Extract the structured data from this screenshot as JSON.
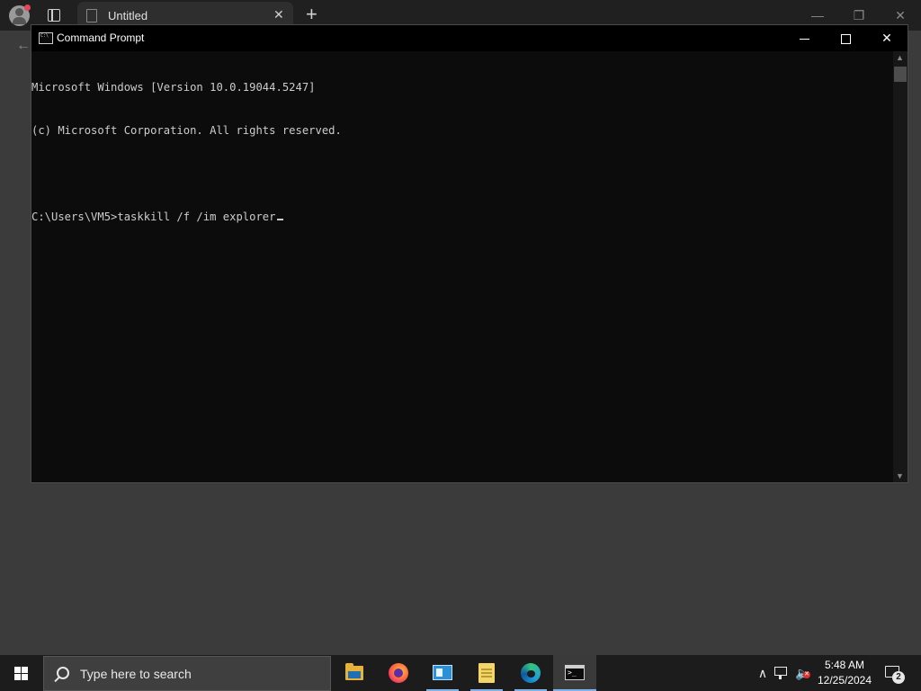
{
  "browser": {
    "tab_title": "Untitled"
  },
  "cmd": {
    "title": "Command Prompt",
    "lines": [
      "Microsoft Windows [Version 10.0.19044.5247]",
      "(c) Microsoft Corporation. All rights reserved.",
      "",
      "C:\\Users\\VM5>taskkill /f /im explorer"
    ]
  },
  "taskbar": {
    "search_placeholder": "Type here to search",
    "time": "5:48 AM",
    "date": "12/25/2024",
    "notification_count": "2",
    "apps": [
      "file-explorer",
      "firefox",
      "app",
      "notes",
      "edge",
      "command-prompt"
    ]
  },
  "colors": {
    "console_bg": "#0c0c0c",
    "console_text": "#cccccc",
    "taskbar_bg": "#1c1c1c",
    "accent_indicator": "#7fb1e6"
  }
}
